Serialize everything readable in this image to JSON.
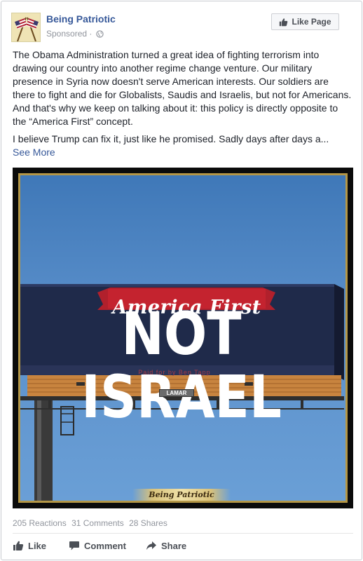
{
  "header": {
    "page_name": "Being Patriotic",
    "sponsored_label": "Sponsored",
    "separator": "·",
    "like_page_label": "Like Page"
  },
  "post": {
    "paragraph_1": "The Obama Administration turned a great idea of fighting terrorism into drawing our country into another regime change venture. Our military presence in Syria now doesn't serve American interests. Our soldiers are there to fight and die for Globalists, Saudis and Israelis, but not for Americans. And that's why we keep on talking about it: this policy is directly opposite to the “America First” concept.",
    "paragraph_2": "I believe Trump can fix it, just like he promised. Sadly days after days a...",
    "see_more_label": "See More"
  },
  "image": {
    "banner_text": "America First",
    "headline_text": "NOT ISRAEL",
    "sponsor_line": "Paid for by Ben Tapp",
    "billboard_brand": "LAMAR",
    "watermark": "Being Patriotic"
  },
  "stats": {
    "reactions": "205 Reactions",
    "comments": "31 Comments",
    "shares": "28 Shares"
  },
  "actions": {
    "like": "Like",
    "comment": "Comment",
    "share": "Share"
  },
  "colors": {
    "link_blue": "#365899",
    "meta_gray": "#90949c",
    "sky": "#5b90cb",
    "billboard_navy": "#1f2a4a",
    "banner_red": "#b1202c",
    "frame_gold": "#b49747"
  },
  "icons": {
    "globe": "globe-icon",
    "thumbs_up": "thumbs-up-icon",
    "comment": "comment-icon",
    "share": "share-arrow-icon"
  }
}
